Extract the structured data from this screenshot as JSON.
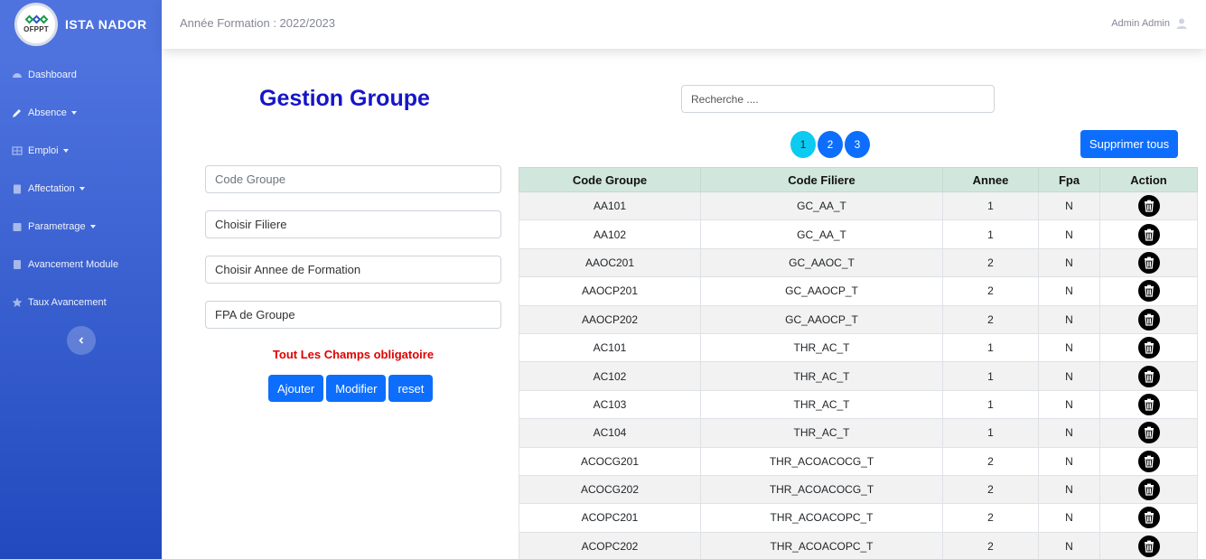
{
  "brand": {
    "logo_text": "OFPPT",
    "name": "ISTA NADOR"
  },
  "sidebar": {
    "items": [
      {
        "label": "Dashboard",
        "icon": "dashboard-icon",
        "dropdown": false
      },
      {
        "label": "Absence",
        "icon": "pencil-icon",
        "dropdown": true
      },
      {
        "label": "Emploi",
        "icon": "table-icon",
        "dropdown": true
      },
      {
        "label": "Affectation",
        "icon": "clipboard-icon",
        "dropdown": true
      },
      {
        "label": "Parametrage",
        "icon": "calendar-icon",
        "dropdown": true
      },
      {
        "label": "Avancement Module",
        "icon": "calculator-icon",
        "dropdown": false
      },
      {
        "label": "Taux Avancement",
        "icon": "star-icon",
        "dropdown": false
      }
    ],
    "toggle_icon": "chevron-left-icon"
  },
  "topbar": {
    "year_label": "Année Formation : 2022/2023",
    "user_name": "Admin Admin",
    "user_icon": "user-icon"
  },
  "page": {
    "title": "Gestion Groupe"
  },
  "search": {
    "placeholder": "Recherche ...."
  },
  "pagination": {
    "pages": [
      "1",
      "2",
      "3"
    ],
    "active": "1"
  },
  "delete_all_label": "Supprimer tous",
  "form": {
    "code_placeholder": "Code Groupe",
    "filiere_value": "Choisir Filiere",
    "annee_value": "Choisir Annee de Formation",
    "fpa_value": "FPA de Groupe",
    "error": "Tout Les Champs obligatoire",
    "buttons": {
      "add": "Ajouter",
      "edit": "Modifier",
      "reset": "reset"
    }
  },
  "table": {
    "headers": [
      "Code Groupe",
      "Code Filiere",
      "Annee",
      "Fpa",
      "Action"
    ],
    "rows": [
      [
        "AA101",
        "GC_AA_T",
        "1",
        "N"
      ],
      [
        "AA102",
        "GC_AA_T",
        "1",
        "N"
      ],
      [
        "AAOC201",
        "GC_AAOC_T",
        "2",
        "N"
      ],
      [
        "AAOCP201",
        "GC_AAOCP_T",
        "2",
        "N"
      ],
      [
        "AAOCP202",
        "GC_AAOCP_T",
        "2",
        "N"
      ],
      [
        "AC101",
        "THR_AC_T",
        "1",
        "N"
      ],
      [
        "AC102",
        "THR_AC_T",
        "1",
        "N"
      ],
      [
        "AC103",
        "THR_AC_T",
        "1",
        "N"
      ],
      [
        "AC104",
        "THR_AC_T",
        "1",
        "N"
      ],
      [
        "ACOCG201",
        "THR_ACOACOCG_T",
        "2",
        "N"
      ],
      [
        "ACOCG202",
        "THR_ACOACOCG_T",
        "2",
        "N"
      ],
      [
        "ACOPC201",
        "THR_ACOACOPC_T",
        "2",
        "N"
      ],
      [
        "ACOPC202",
        "THR_ACOACOPC_T",
        "2",
        "N"
      ]
    ],
    "action_icon": "trash-icon"
  }
}
